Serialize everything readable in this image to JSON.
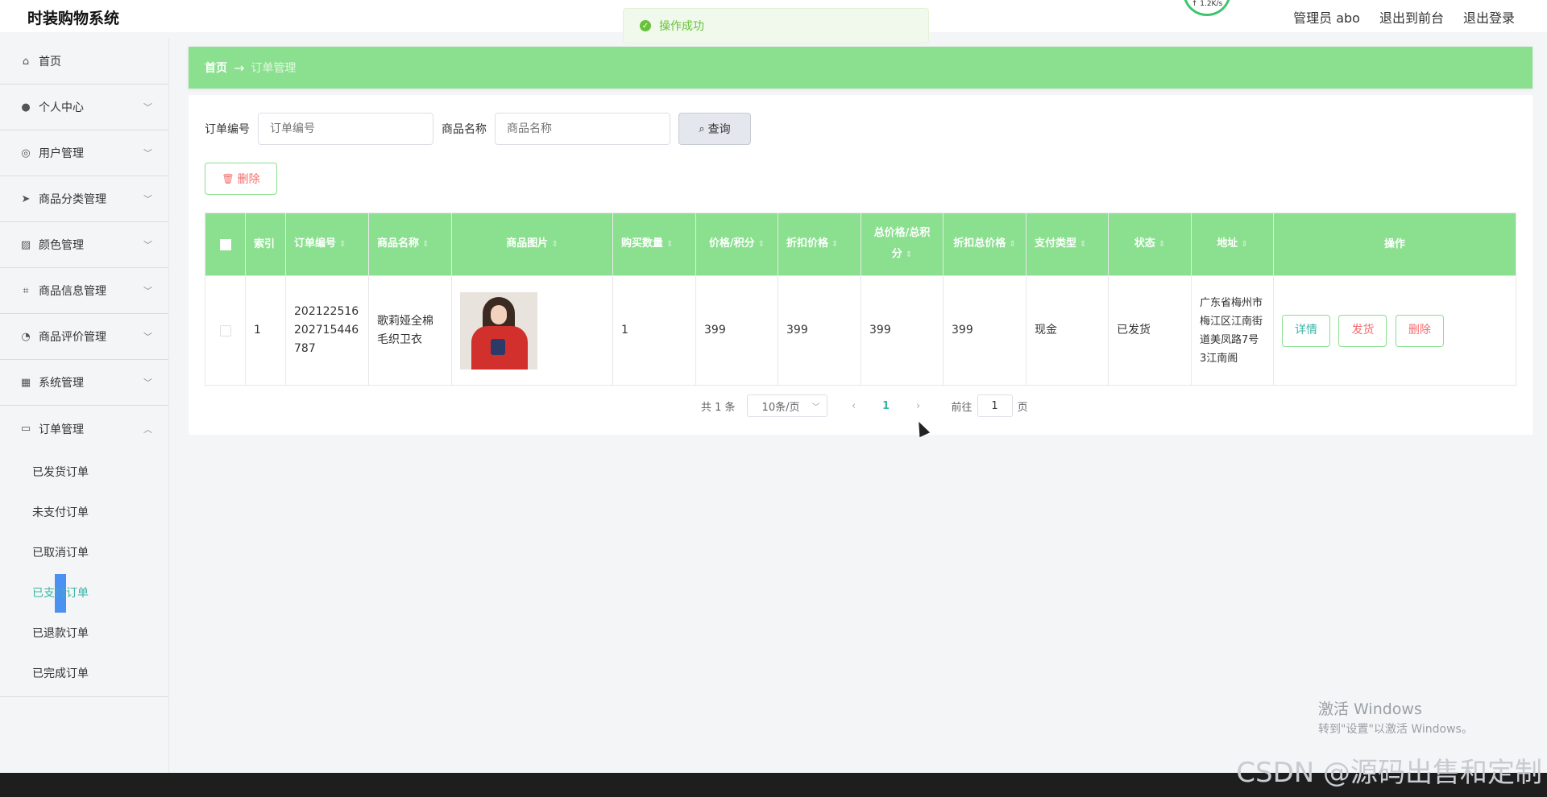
{
  "app": {
    "title": "时装购物系统"
  },
  "topbar": {
    "admin_label": "管理员 abo",
    "frontend_link": "退出到前台",
    "logout_link": "退出登录",
    "net_speed": "↑ 1.2K/s"
  },
  "toast": {
    "message": "操作成功"
  },
  "sidebar": {
    "items": [
      {
        "label": "首页",
        "icon": "home-icon"
      },
      {
        "label": "个人中心",
        "icon": "user-icon"
      },
      {
        "label": "用户管理",
        "icon": "target-icon"
      },
      {
        "label": "商品分类管理",
        "icon": "send-icon"
      },
      {
        "label": "颜色管理",
        "icon": "chart-icon"
      },
      {
        "label": "商品信息管理",
        "icon": "crop-icon"
      },
      {
        "label": "商品评价管理",
        "icon": "compass-icon"
      },
      {
        "label": "系统管理",
        "icon": "grid-icon"
      },
      {
        "label": "订单管理",
        "icon": "chat-icon"
      }
    ],
    "order_subitems": [
      "已发货订单",
      "未支付订单",
      "已取消订单",
      "已支付订单",
      "已退款订单",
      "已完成订单"
    ],
    "active_subitem": "已支付订单"
  },
  "breadcrumb": {
    "home": "首页",
    "arrow": "→",
    "current": "订单管理"
  },
  "search": {
    "order_no_label": "订单编号",
    "order_no_placeholder": "订单编号",
    "product_name_label": "商品名称",
    "product_name_placeholder": "商品名称",
    "query_button": "查询"
  },
  "toolbar": {
    "delete_button": "删除"
  },
  "table": {
    "headers": [
      "索引",
      "订单编号",
      "商品名称",
      "商品图片",
      "购买数量",
      "价格/积分",
      "折扣价格",
      "总价格/总积分",
      "折扣总价格",
      "支付类型",
      "状态",
      "地址",
      "操作"
    ],
    "rows": [
      {
        "index": "1",
        "order_no": "202122516202715446787",
        "product_name": "歌莉娅全棉毛织卫衣",
        "image": "red-sweater-photo",
        "quantity": "1",
        "price": "399",
        "discount_price": "399",
        "total_price": "399",
        "discount_total": "399",
        "pay_type": "现金",
        "status": "已发货",
        "address": "广东省梅州市梅江区江南街道美凤路7号3江南阁",
        "actions": {
          "detail": "详情",
          "ship": "发货",
          "delete": "删除"
        }
      }
    ]
  },
  "pagination": {
    "total_text": "共 1 条",
    "page_size": "10条/页",
    "current_page": "1",
    "goto_label": "前往",
    "goto_value": "1",
    "page_unit": "页"
  },
  "watermark": {
    "windows_line1": "激活 Windows",
    "windows_line2": "转到\"设置\"以激活 Windows。",
    "csdn": "CSDN @源码出售和定制"
  },
  "colors": {
    "accent_green": "#8ae08e",
    "active_teal": "#3ab5a4",
    "danger": "#f56c6c"
  }
}
